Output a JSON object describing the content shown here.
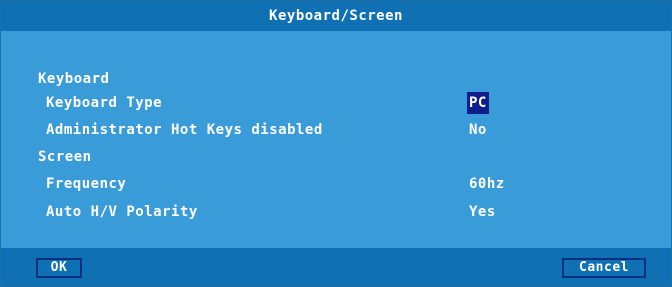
{
  "dialog": {
    "title": "Keyboard/Screen"
  },
  "keyboard_section": {
    "heading": "Keyboard",
    "keyboard_type": {
      "label": "Keyboard Type",
      "value": "PC"
    },
    "admin_hot_keys": {
      "label": "Administrator Hot Keys disabled",
      "value": "No"
    }
  },
  "screen_section": {
    "heading": "Screen",
    "frequency": {
      "label": "Frequency",
      "value": "60hz"
    },
    "auto_polarity": {
      "label": "Auto H/V Polarity",
      "value": "Yes"
    }
  },
  "footer": {
    "ok_label": "OK",
    "cancel_label": "Cancel"
  },
  "colors": {
    "panel": "#3a9bd9",
    "titlebar": "#1070b4",
    "selection": "#0f1e8c",
    "text": "#ffffff"
  }
}
